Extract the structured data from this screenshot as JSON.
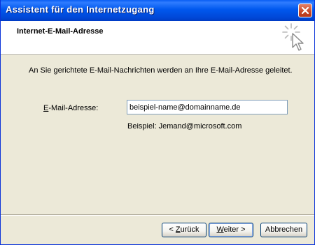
{
  "window": {
    "title": "Assistent für den Internetzugang",
    "close_icon": "close-icon"
  },
  "header": {
    "title": "Internet-E-Mail-Adresse",
    "icon": "wizard-cursor-icon"
  },
  "main": {
    "description": "An Sie gerichtete E-Mail-Nachrichten werden an Ihre E-Mail-Adresse geleitet.",
    "email_label_mnemonic": "E",
    "email_label_rest": "-Mail-Adresse:",
    "email_value": "beispiel-name@domainname.de",
    "example": "Beispiel: Jemand@microsoft.com"
  },
  "buttons": {
    "back_prefix": "< ",
    "back_mnemonic": "Z",
    "back_rest": "urück",
    "next_mnemonic": "W",
    "next_rest": "eiter >",
    "cancel": "Abbrechen"
  },
  "colors": {
    "titlebar": "#0058ee",
    "dialog_background": "#ece9d8",
    "close_button": "#c84726"
  }
}
